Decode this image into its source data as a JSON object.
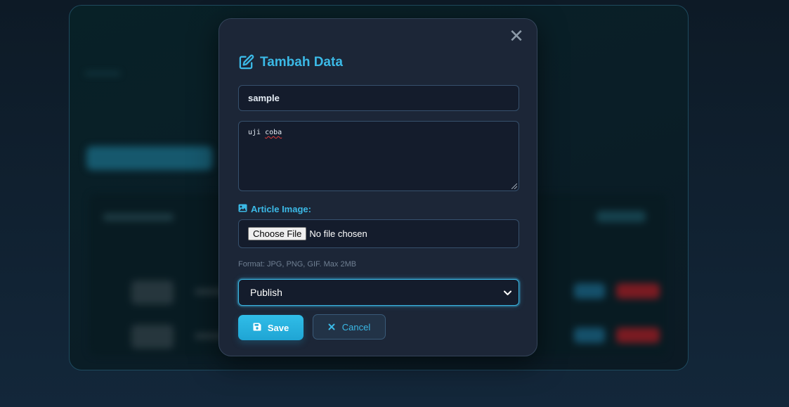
{
  "modal": {
    "title": "Tambah Data",
    "close_symbol": "✕",
    "title_input_value": "sample",
    "content_textarea_value_before": "uji ",
    "content_textarea_value_misspelled": "coba",
    "image_label": "Article Image:",
    "file_button_label": "Choose File",
    "file_status": "No file chosen",
    "format_hint": "Format: JPG, PNG, GIF. Max 2MB",
    "status_select_value": "Publish",
    "save_label": "Save",
    "cancel_label": "Cancel"
  },
  "icons": {
    "title": "edit-icon",
    "image_label": "image-icon",
    "save": "floppy-disk-icon",
    "cancel": "x-icon",
    "select": "chevron-down-icon",
    "close": "close-icon"
  },
  "colors": {
    "accent": "#3bb9e6",
    "modal_bg": "#1c2637",
    "field_bg": "#141c2c",
    "page_bg": "#0d1a26"
  }
}
